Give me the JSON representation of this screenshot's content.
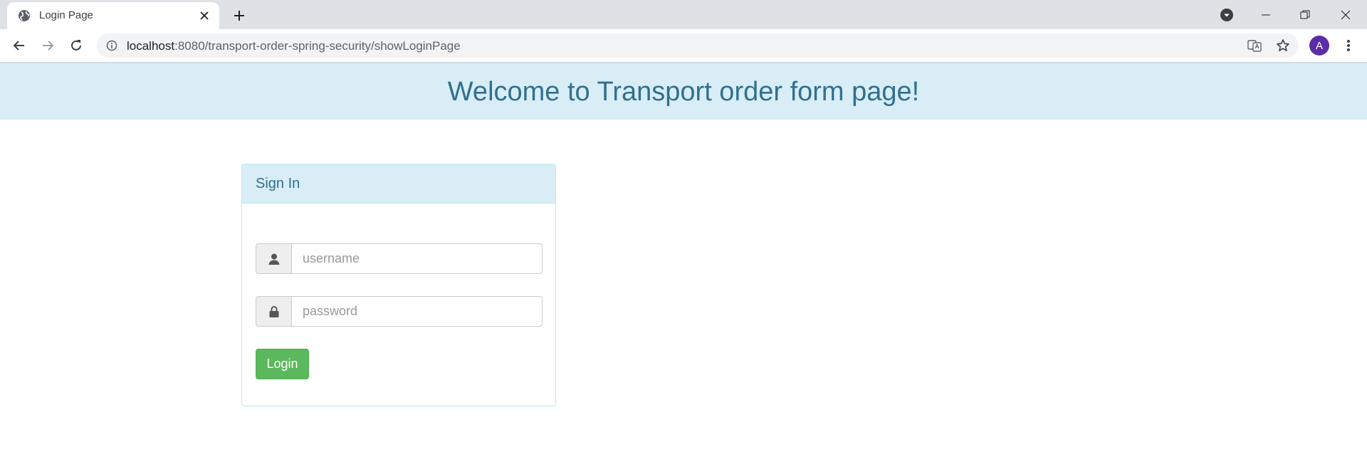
{
  "browser": {
    "tab": {
      "title": "Login Page",
      "favicon": "globe-icon"
    },
    "address": {
      "host": "localhost",
      "path": ":8080/transport-order-spring-security/showLoginPage"
    }
  },
  "page": {
    "header": {
      "title": "Welcome to Transport order form page!"
    },
    "login_panel": {
      "heading": "Sign In",
      "username": {
        "placeholder": "username",
        "value": "",
        "icon": "user-icon"
      },
      "password": {
        "placeholder": "password",
        "value": "",
        "icon": "lock-icon"
      },
      "submit_label": "Login"
    }
  },
  "profile": {
    "initial": "A",
    "color": "#5c2da8"
  },
  "colors": {
    "banner_bg": "#d9edf7",
    "banner_text": "#31708f",
    "panel_border": "#bce8f1",
    "success": "#5cb85c"
  }
}
